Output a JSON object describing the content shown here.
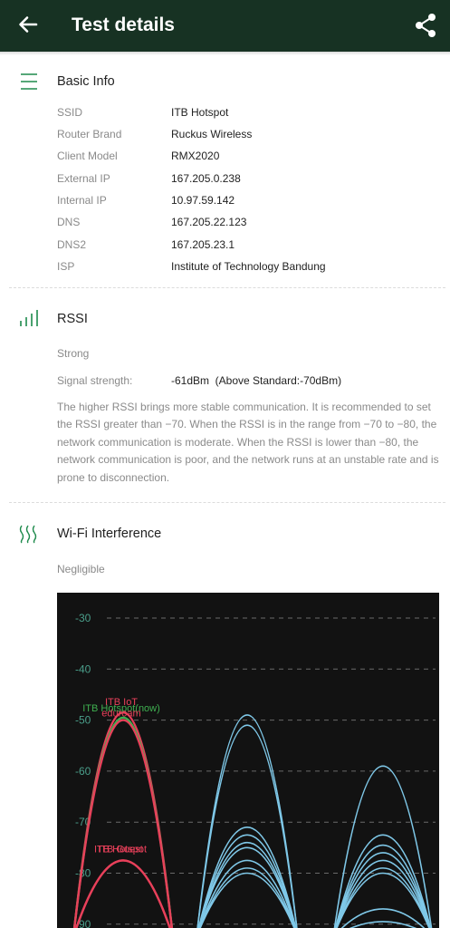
{
  "appbar": {
    "title": "Test details",
    "back_icon": "arrow-left-icon",
    "share_icon": "share-icon",
    "bg": "#173223"
  },
  "basic_info": {
    "title": "Basic Info",
    "icon": "list-icon",
    "rows": [
      {
        "label": "SSID",
        "value": "ITB Hotspot"
      },
      {
        "label": "Router Brand",
        "value": "Ruckus Wireless"
      },
      {
        "label": "Client Model",
        "value": "RMX2020"
      },
      {
        "label": "External IP",
        "value": "167.205.0.238"
      },
      {
        "label": "Internal IP",
        "value": "10.97.59.142"
      },
      {
        "label": "DNS",
        "value": "167.205.22.123"
      },
      {
        "label": "DNS2",
        "value": "167.205.23.1"
      },
      {
        "label": "ISP",
        "value": "Institute of Technology Bandung"
      }
    ]
  },
  "rssi": {
    "title": "RSSI",
    "icon": "signal-bars-icon",
    "status": "Strong",
    "strength_label": "Signal strength:",
    "strength_value": "-61dBm  (Above Standard:-70dBm)",
    "description": "The higher RSSI brings more stable communication. It is recommended to set the RSSI greater than −70. When the RSSI is in the range from −70 to −80, the network communication is moderate. When the RSSI is lower than −80, the network communication is poor, and the network runs at an unstable rate and is prone to disconnection."
  },
  "interference": {
    "title": "Wi-Fi Interference",
    "icon": "waves-icon",
    "status": "Negligible"
  },
  "colors": {
    "accent": "#1e8a4c",
    "red": "#e8405a",
    "green": "#3fb050",
    "blue": "#7fc8e8",
    "tick": "#4a9e8a"
  },
  "chart_data": {
    "type": "line",
    "ylim": [
      -90,
      -28
    ],
    "y_ticks": [
      "-30",
      "-40",
      "-50",
      "-60",
      "-70",
      "-80",
      "-90"
    ],
    "y_tick_values": [
      -30,
      -40,
      -50,
      -60,
      -70,
      -80,
      -90
    ],
    "series": [
      {
        "name": "ITB IoT",
        "group": 1,
        "peak": -48.5,
        "color": "#e8405a"
      },
      {
        "name": "ITB Hotspot(now)",
        "group": 1,
        "peak": -49.5,
        "color": "#3fb050"
      },
      {
        "name": "eduroam",
        "group": 1,
        "peak": -50.0,
        "color": "#e8405a"
      },
      {
        "name": "ITB Guest",
        "group": 1,
        "peak": -77.5,
        "color": "#e8405a"
      },
      {
        "name": "ITB Hotspot",
        "group": 1,
        "peak": -77.5,
        "color": "#e8405a"
      },
      {
        "name": "",
        "group": 2,
        "peak": -49.0,
        "color": "#7fc8e8"
      },
      {
        "name": "",
        "group": 2,
        "peak": -51.0,
        "color": "#7fc8e8"
      },
      {
        "name": "",
        "group": 2,
        "peak": -71.0,
        "color": "#7fc8e8"
      },
      {
        "name": "",
        "group": 2,
        "peak": -72.5,
        "color": "#7fc8e8"
      },
      {
        "name": "",
        "group": 2,
        "peak": -74.0,
        "color": "#7fc8e8"
      },
      {
        "name": "",
        "group": 2,
        "peak": -75.0,
        "color": "#7fc8e8"
      },
      {
        "name": "",
        "group": 2,
        "peak": -77.5,
        "color": "#7fc8e8"
      },
      {
        "name": "",
        "group": 2,
        "peak": -79.0,
        "color": "#7fc8e8"
      },
      {
        "name": "",
        "group": 2,
        "peak": -80.0,
        "color": "#7fc8e8"
      },
      {
        "name": "",
        "group": 3,
        "peak": -59.0,
        "color": "#7fc8e8"
      },
      {
        "name": "",
        "group": 3,
        "peak": -72.5,
        "color": "#7fc8e8"
      },
      {
        "name": "",
        "group": 3,
        "peak": -74.5,
        "color": "#7fc8e8"
      },
      {
        "name": "",
        "group": 3,
        "peak": -76.0,
        "color": "#7fc8e8"
      },
      {
        "name": "",
        "group": 3,
        "peak": -77.5,
        "color": "#7fc8e8"
      },
      {
        "name": "",
        "group": 3,
        "peak": -79.0,
        "color": "#7fc8e8"
      },
      {
        "name": "",
        "group": 3,
        "peak": -80.0,
        "color": "#7fc8e8"
      },
      {
        "name": "",
        "group": 3,
        "peak": -87.0,
        "color": "#7fc8e8"
      },
      {
        "name": "",
        "group": 3,
        "peak": -89.5,
        "color": "#7fc8e8"
      }
    ]
  }
}
